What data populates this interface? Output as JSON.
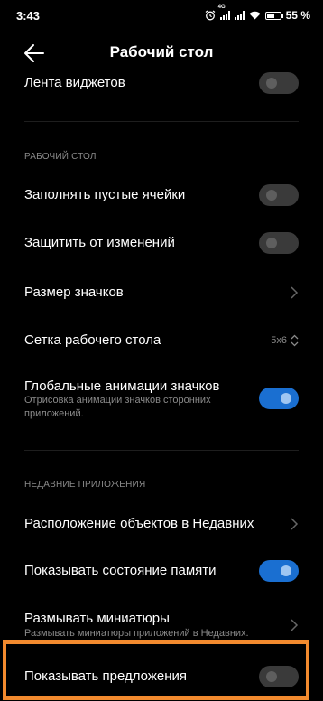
{
  "status_bar": {
    "time": "3:43",
    "battery": "55"
  },
  "header": {
    "title": "Рабочий стол"
  },
  "rows": {
    "widgets": {
      "label": "Лента виджетов",
      "toggle_on": false
    },
    "section_desktop": "РАБОЧИЙ СТОЛ",
    "fill_empty": {
      "label": "Заполнять пустые ячейки",
      "toggle_on": false
    },
    "protect": {
      "label": "Защитить от изменений",
      "toggle_on": false
    },
    "icon_size": {
      "label": "Размер значков"
    },
    "grid": {
      "label": "Сетка рабочего стола",
      "value": "5x6"
    },
    "global_anim": {
      "label": "Глобальные анимации значков",
      "sub": "Отрисовка анимации значков сторонних приложений.",
      "toggle_on": true
    },
    "section_recent": "НЕДАВНИЕ ПРИЛОЖЕНИЯ",
    "layout_recent": {
      "label": "Расположение объектов в Недавних"
    },
    "memory": {
      "label": "Показывать состояние памяти",
      "toggle_on": true
    },
    "blur": {
      "label": "Размывать миниатюры",
      "sub": "Размывать миниатюры приложений в Недавних."
    },
    "suggestions": {
      "label": "Показывать предложения",
      "toggle_on": false
    }
  }
}
